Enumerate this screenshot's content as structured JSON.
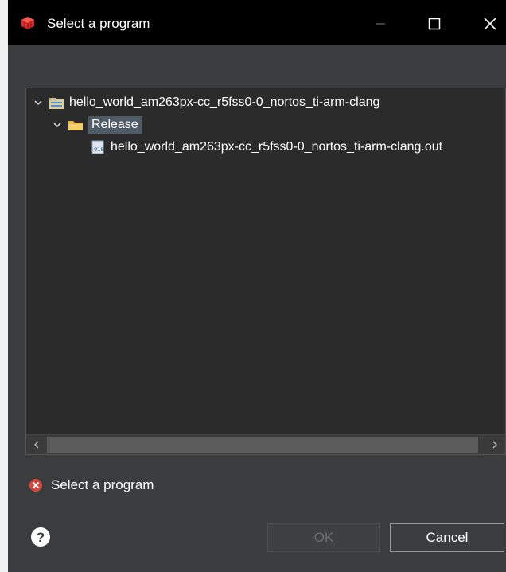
{
  "window": {
    "title": "Select a program",
    "controls": {
      "minimize_icon": "minimize-icon",
      "maximize_icon": "maximize-icon",
      "close_icon": "close-icon"
    }
  },
  "tree": {
    "project": {
      "label": "hello_world_am263px-cc_r5fss0-0_nortos_ti-arm-clang",
      "icon": "project-folder-icon",
      "expanded": true
    },
    "folder": {
      "label": "Release",
      "icon": "folder-icon",
      "expanded": true,
      "selected": true
    },
    "file": {
      "label": "hello_world_am263px-cc_r5fss0-0_nortos_ti-arm-clang.out",
      "icon": "binary-file-icon"
    }
  },
  "status": {
    "message": "Select a program",
    "icon": "error-icon"
  },
  "buttons": {
    "ok": "OK",
    "cancel": "Cancel"
  },
  "colors": {
    "dialog_bg": "#3b3c3e",
    "tree_bg": "#2b2b2b",
    "selection_bg": "#4f5b66",
    "error_red": "#d9453d"
  }
}
